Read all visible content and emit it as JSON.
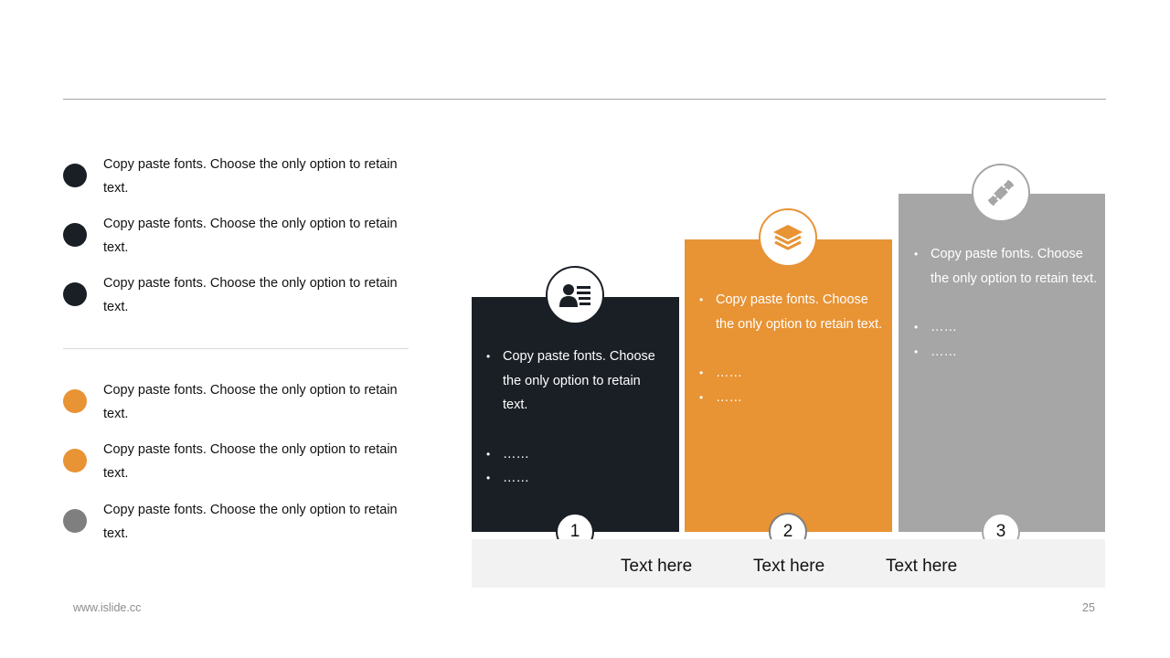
{
  "colors": {
    "dark": "#1a1f26",
    "orange": "#e89334",
    "gray": "#a6a6a6",
    "gray_dark": "#7f7f7f",
    "base": "#f2f2f2"
  },
  "left_list": {
    "group1": [
      {
        "text": "Copy paste fonts. Choose the only option to retain text.",
        "color": "#1a1f26"
      },
      {
        "text": "Copy paste fonts. Choose the only option to retain text.",
        "color": "#1a1f26"
      },
      {
        "text": "Copy paste fonts. Choose the only option to retain text.",
        "color": "#1a1f26"
      }
    ],
    "group2": [
      {
        "text": "Copy paste fonts. Choose the only option to retain text.",
        "color": "#e89334"
      },
      {
        "text": "Copy paste fonts. Choose the only option to retain text.",
        "color": "#e89334"
      },
      {
        "text": "Copy paste fonts. Choose the only option to retain text.",
        "color": "#7f7f7f"
      }
    ]
  },
  "columns": [
    {
      "number": "1",
      "icon": "user-list-icon",
      "color": "#1a1f26",
      "bullets": [
        "Copy paste fonts. Choose the only option to retain text.",
        "……",
        "……"
      ]
    },
    {
      "number": "2",
      "icon": "layers-icon",
      "color": "#e89334",
      "bullets": [
        "Copy paste fonts. Choose the only option to retain text.",
        "……",
        "……"
      ]
    },
    {
      "number": "3",
      "icon": "satellite-icon",
      "color": "#a6a6a6",
      "bullets": [
        "Copy paste fonts. Choose the only option to retain text.",
        "……",
        "……"
      ]
    }
  ],
  "base_labels": [
    "Text here",
    "Text here",
    "Text here"
  ],
  "footer": {
    "website": "www.islide.cc",
    "page_number": "25"
  }
}
